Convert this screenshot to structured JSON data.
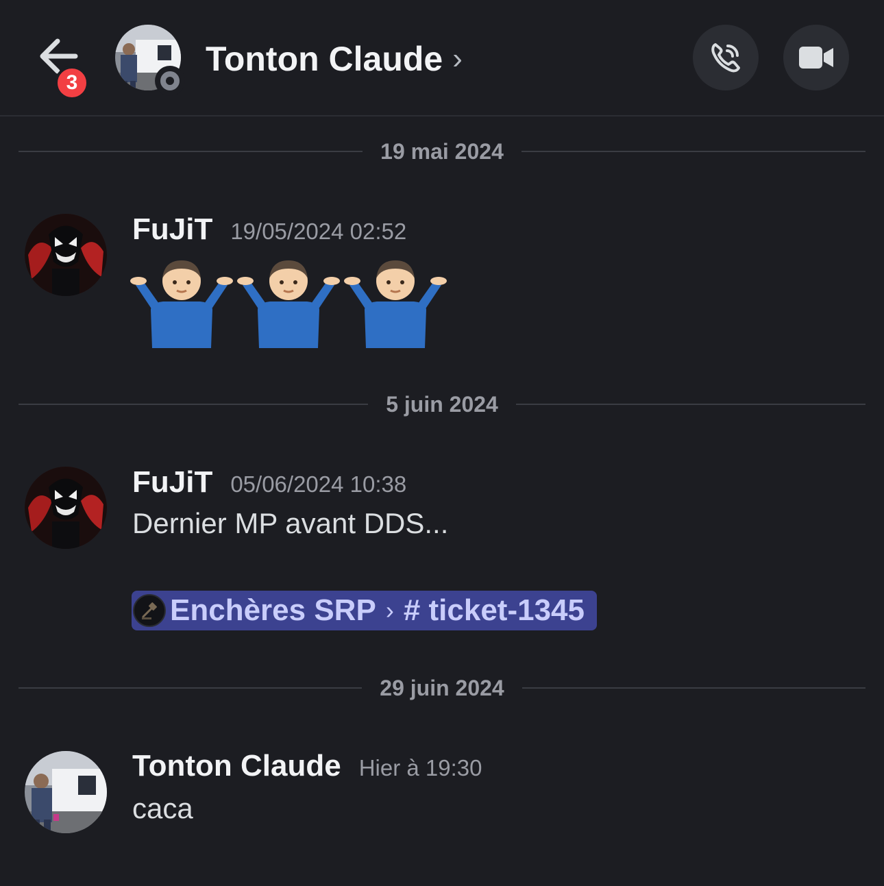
{
  "header": {
    "back_icon": "arrow-left-icon",
    "unread_count": "3",
    "contact_name": "Tonton Claude",
    "chevron": "›",
    "call_icon": "phone-call-icon",
    "video_icon": "video-camera-icon",
    "status": "offline"
  },
  "dividers": [
    {
      "label": "19 mai 2024"
    },
    {
      "label": "5 juin 2024"
    },
    {
      "label": "29 juin 2024"
    }
  ],
  "messages": [
    {
      "author": "FuJiT",
      "timestamp": "19/05/2024 02:52",
      "content": "🤷🏻‍♂️🤷🏻‍♂️🤷🏻‍♂️",
      "emoji": "person-shrugging"
    },
    {
      "author": "FuJiT",
      "timestamp": "05/06/2024 10:38",
      "content": "Dernier MP avant DDS...",
      "mention": {
        "server": "Enchères SRP",
        "separator": "›",
        "channel": "# ticket-1345"
      }
    },
    {
      "author": "Tonton Claude",
      "timestamp": "Hier à 19:30",
      "content": "caca"
    }
  ],
  "colors": {
    "background": "#1c1d22",
    "mention_bg": "#3c4290",
    "mention_text": "#c9cdfb",
    "badge": "#f23f43",
    "muted": "#9a9ca4"
  }
}
